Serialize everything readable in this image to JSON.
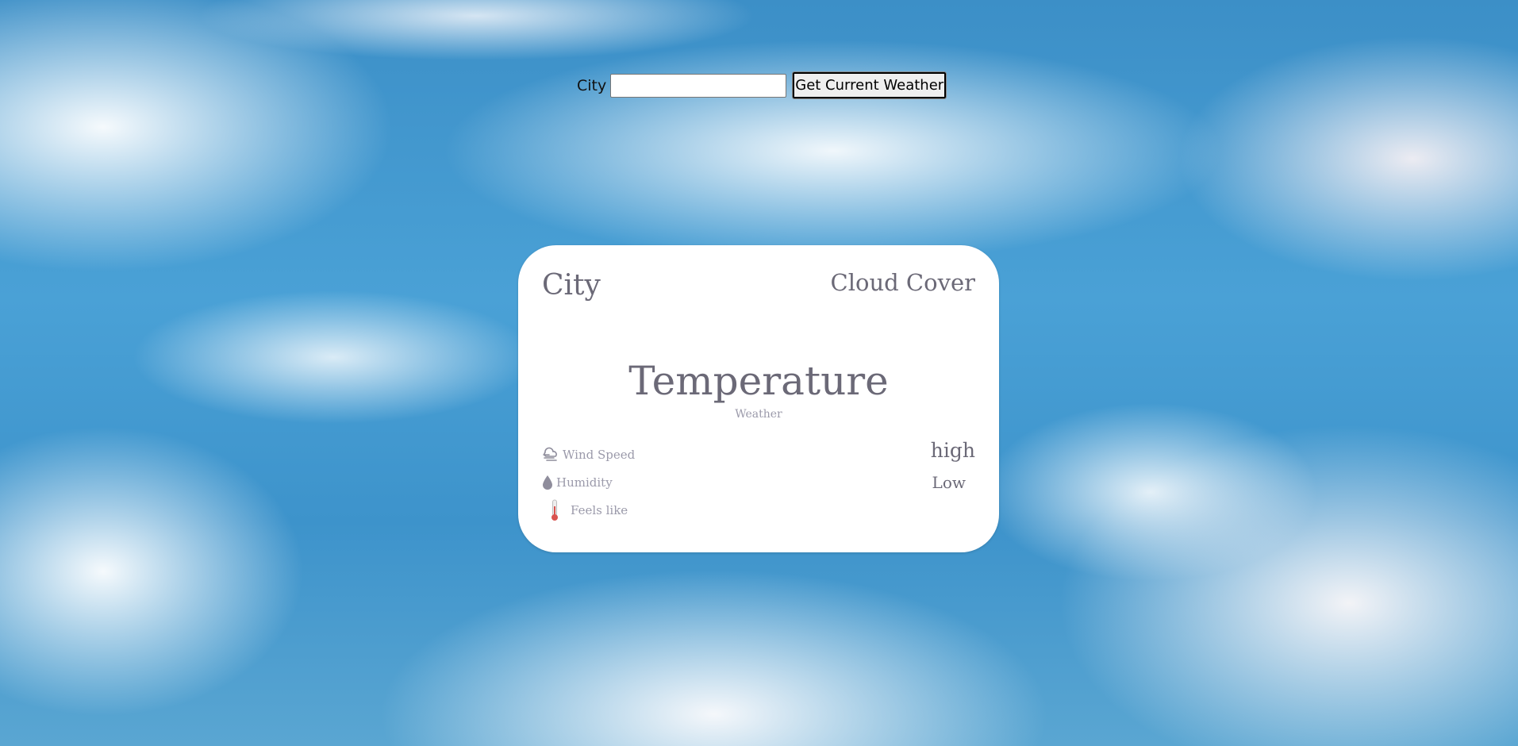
{
  "search": {
    "label": "City",
    "input_value": "",
    "button_label": "Get Current Weather"
  },
  "card": {
    "city": "City",
    "cloud_cover": "Cloud Cover",
    "temperature": "Temperature",
    "weather": "Weather",
    "wind_speed_label": "Wind Speed",
    "humidity_label": "Humidity",
    "feels_like_label": "Feels like",
    "high": "high",
    "low": "Low"
  },
  "icons": {
    "wind": "wind-icon",
    "humidity": "droplet-icon",
    "feels_like": "thermometer-icon"
  },
  "colors": {
    "card_text": "#6b6977",
    "muted_text": "#9b9aaa",
    "thermometer": "#d9534f"
  }
}
